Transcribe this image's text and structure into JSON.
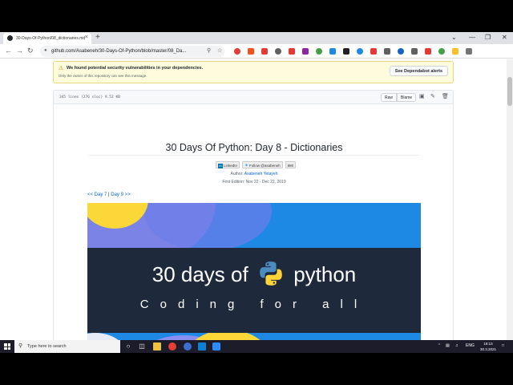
{
  "browser": {
    "tab_title": "30-Days-Of-Python/08_dictionaries.md",
    "tab_close": "×",
    "new_tab": "+",
    "window_controls": [
      "⌄",
      "—",
      "❐",
      "✕"
    ],
    "nav": {
      "back": "←",
      "forward": "→",
      "reload": "↻"
    },
    "url": "github.com/Asabeneh/30-Days-Of-Python/blob/master/08_Da...",
    "extension_colors": [
      "#e53935",
      "#f4511e",
      "#e53935",
      "#616161",
      "#e53935",
      "#8e24aa",
      "#43a047",
      "#1e88e5",
      "#212121",
      "#1e88e5",
      "#e53935",
      "#616161",
      "#1565c0",
      "#616161",
      "#e53935",
      "#43a047",
      "#fbc02d",
      "#757575"
    ]
  },
  "alert": {
    "title": "We found potential security vulnerabilities in your dependencies.",
    "subtitle": "Only the owner of this repository can see this message.",
    "button": "See Dependabot alerts"
  },
  "file": {
    "info": "345 lines (276 sloc)   9.52 KB",
    "raw": "Raw",
    "blame": "Blame"
  },
  "doc": {
    "title": "30 Days Of Python: Day 8 - Dictionaries",
    "badge_linkedin": "LinkedIn",
    "badge_follow": "Follow @asabeneh",
    "badge_count": "880",
    "author_label": "Author:",
    "author_name": "Asabeneh Yetayeh",
    "edition": "First Edition: Nov 22 - Dec 22, 2019",
    "prev_link": "<< Day 7",
    "sep": "|",
    "next_link": "Day 9 >>"
  },
  "banner": {
    "line1_a": "30 days of",
    "line1_b": "python",
    "line2": "Coding for all"
  },
  "taskbar": {
    "search_placeholder": "Type here to search",
    "lang": "ENG",
    "time": "18:13",
    "date": "30.3.2021"
  }
}
